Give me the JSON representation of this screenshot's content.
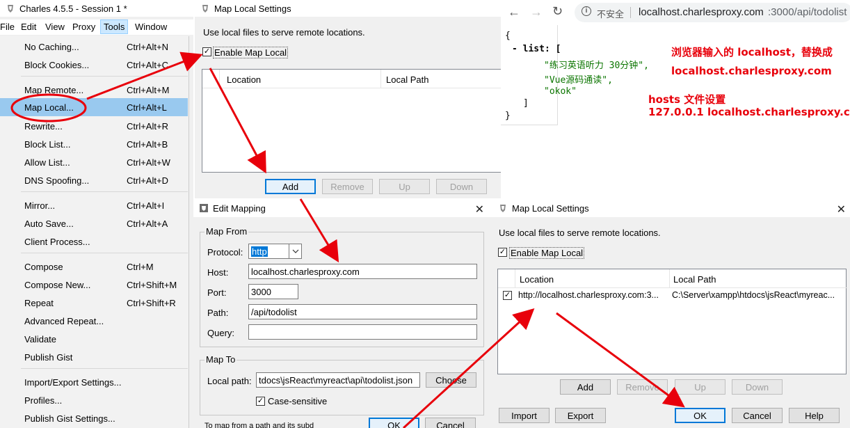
{
  "charles": {
    "title": "Charles 4.5.5 - Session 1 *",
    "menubar": [
      "File",
      "Edit",
      "View",
      "Proxy",
      "Tools",
      "Window"
    ],
    "menu_items": [
      {
        "label": "No Caching...",
        "shortcut": "Ctrl+Alt+N"
      },
      {
        "label": "Block Cookies...",
        "shortcut": "Ctrl+Alt+C"
      },
      {
        "label": "Map Remote...",
        "shortcut": "Ctrl+Alt+M"
      },
      {
        "label": "Map Local...",
        "shortcut": "Ctrl+Alt+L"
      },
      {
        "label": "Rewrite...",
        "shortcut": "Ctrl+Alt+R"
      },
      {
        "label": "Block List...",
        "shortcut": "Ctrl+Alt+B"
      },
      {
        "label": "Allow List...",
        "shortcut": "Ctrl+Alt+W"
      },
      {
        "label": "DNS Spoofing...",
        "shortcut": "Ctrl+Alt+D"
      },
      {
        "label": "Mirror...",
        "shortcut": "Ctrl+Alt+I"
      },
      {
        "label": "Auto Save...",
        "shortcut": "Ctrl+Alt+A"
      },
      {
        "label": "Client Process...",
        "shortcut": ""
      },
      {
        "label": "Compose",
        "shortcut": "Ctrl+M"
      },
      {
        "label": "Compose New...",
        "shortcut": "Ctrl+Shift+M"
      },
      {
        "label": "Repeat",
        "shortcut": "Ctrl+Shift+R"
      },
      {
        "label": "Advanced Repeat...",
        "shortcut": ""
      },
      {
        "label": "Validate",
        "shortcut": ""
      },
      {
        "label": "Publish Gist",
        "shortcut": ""
      },
      {
        "label": "Import/Export Settings...",
        "shortcut": ""
      },
      {
        "label": "Profiles...",
        "shortcut": ""
      },
      {
        "label": "Publish Gist Settings...",
        "shortcut": ""
      }
    ]
  },
  "map_local_1": {
    "title": "Map Local Settings",
    "description": "Use local files to serve remote locations.",
    "enable_label": "Enable Map Local",
    "enable_checked": true,
    "columns": [
      "Location",
      "Local Path"
    ],
    "buttons": {
      "add": "Add",
      "remove": "Remove",
      "up": "Up",
      "down": "Down"
    }
  },
  "edit_mapping": {
    "title": "Edit Mapping",
    "map_from_title": "Map From",
    "protocol_label": "Protocol:",
    "protocol_value": "http",
    "host_label": "Host:",
    "host_value": "localhost.charlesproxy.com",
    "port_label": "Port:",
    "port_value": "3000",
    "path_label": "Path:",
    "path_value": "/api/todolist",
    "query_label": "Query:",
    "query_value": "",
    "map_to_title": "Map To",
    "local_path_label": "Local path:",
    "local_path_value": "tdocs\\jsReact\\myreact\\api\\todolist.json",
    "choose_label": "Choose",
    "case_label": "Case-sensitive",
    "case_checked": true,
    "footer_text": "To map from a path and its subd",
    "ok_label": "OK",
    "cancel_label": "Cancel"
  },
  "map_local_2": {
    "title": "Map Local Settings",
    "description": "Use local files to serve remote locations.",
    "enable_label": "Enable Map Local",
    "enable_checked": true,
    "columns": [
      "Location",
      "Local Path"
    ],
    "rows": [
      {
        "checked": true,
        "location": "http://localhost.charlesproxy.com:3...",
        "local_path": "C:\\Server\\xampp\\htdocs\\jsReact\\myreac..."
      }
    ],
    "buttons": {
      "add": "Add",
      "remove": "Remove",
      "up": "Up",
      "down": "Down",
      "import": "Import",
      "export": "Export",
      "ok": "OK",
      "cancel": "Cancel",
      "help": "Help"
    }
  },
  "browser": {
    "security_label": "不安全",
    "url_host": "localhost.charlesproxy.com",
    "url_rest": ":3000/api/todolist",
    "json_lines": [
      "{",
      "- list: [",
      "\"练习英语听力 30分钟\",",
      "\"Vue源码通读\",",
      "\"okok\"",
      "]",
      "}"
    ]
  },
  "annotations": {
    "line1": "浏览器输入的 localhost，替换成",
    "line2": "localhost.charlesproxy.com",
    "line3": "hosts 文件设置",
    "line4": "127.0.0.1 localhost.charlesproxy.com"
  },
  "colors": {
    "arrow": "#e8000b",
    "highlight": "#99c9ef",
    "accent": "#0078d7"
  }
}
